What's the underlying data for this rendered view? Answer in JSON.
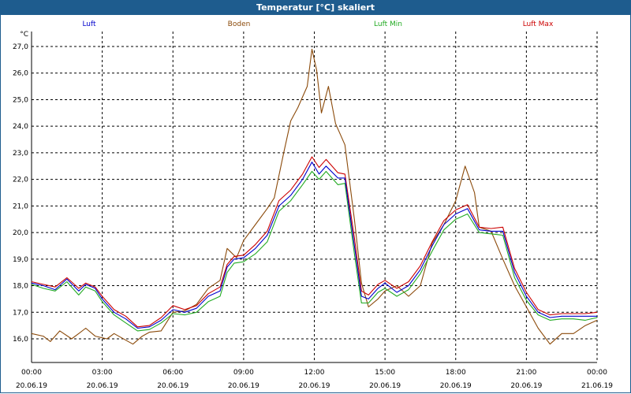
{
  "window": {
    "title": "Temperatur [°C] skaliert"
  },
  "colors": {
    "titlebar": "#1e5c8e",
    "luft": "#0000cc",
    "boden": "#8b4a0a",
    "luft_min": "#22aa22",
    "luft_max": "#cc0000",
    "grid": "#000000"
  },
  "chart_data": {
    "type": "line",
    "title": "Temperatur [°C] skaliert",
    "ylabel": "°C",
    "ylim": [
      15.5,
      27.2
    ],
    "yticks": [
      "27,0",
      "26,0",
      "25,0",
      "24,0",
      "23,0",
      "22,0",
      "21,0",
      "20,0",
      "19,0",
      "18,0",
      "17,0",
      "16,0"
    ],
    "ytick_values": [
      27,
      26,
      25,
      24,
      23,
      22,
      21,
      20,
      19,
      18,
      17,
      16
    ],
    "xlim_hours": [
      0,
      24
    ],
    "xticks": [
      {
        "hour": 0,
        "time": "00:00",
        "date": "20.06.19"
      },
      {
        "hour": 3,
        "time": "03:00",
        "date": "20.06.19"
      },
      {
        "hour": 6,
        "time": "06:00",
        "date": "20.06.19"
      },
      {
        "hour": 9,
        "time": "09:00",
        "date": "20.06.19"
      },
      {
        "hour": 12,
        "time": "12:00",
        "date": "20.06.19"
      },
      {
        "hour": 15,
        "time": "15:00",
        "date": "20.06.19"
      },
      {
        "hour": 18,
        "time": "18:00",
        "date": "20.06.19"
      },
      {
        "hour": 21,
        "time": "21:00",
        "date": "20.06.19"
      },
      {
        "hour": 24,
        "time": "00:00",
        "date": "21.06.19"
      }
    ],
    "grid": true,
    "legend_position": "top",
    "series": [
      {
        "name": "Luft",
        "color_key": "luft",
        "points": [
          [
            0,
            18.1
          ],
          [
            0.5,
            18.0
          ],
          [
            1,
            17.85
          ],
          [
            1.5,
            18.25
          ],
          [
            2,
            17.8
          ],
          [
            2.3,
            18.05
          ],
          [
            2.7,
            17.9
          ],
          [
            3,
            17.5
          ],
          [
            3.5,
            17.0
          ],
          [
            4,
            16.75
          ],
          [
            4.5,
            16.4
          ],
          [
            5,
            16.45
          ],
          [
            5.5,
            16.7
          ],
          [
            6,
            17.1
          ],
          [
            6.5,
            17.0
          ],
          [
            7,
            17.15
          ],
          [
            7.5,
            17.6
          ],
          [
            8,
            17.8
          ],
          [
            8.3,
            18.7
          ],
          [
            8.6,
            19.0
          ],
          [
            9,
            19.05
          ],
          [
            9.5,
            19.4
          ],
          [
            10,
            19.9
          ],
          [
            10.5,
            21.0
          ],
          [
            11,
            21.4
          ],
          [
            11.5,
            22.0
          ],
          [
            11.9,
            22.65
          ],
          [
            12.2,
            22.2
          ],
          [
            12.5,
            22.5
          ],
          [
            13,
            22.05
          ],
          [
            13.3,
            22.05
          ],
          [
            13.7,
            19.5
          ],
          [
            14,
            17.6
          ],
          [
            14.3,
            17.5
          ],
          [
            14.7,
            17.9
          ],
          [
            15,
            18.1
          ],
          [
            15.5,
            17.75
          ],
          [
            16,
            18.0
          ],
          [
            16.5,
            18.6
          ],
          [
            17,
            19.5
          ],
          [
            17.5,
            20.3
          ],
          [
            18,
            20.7
          ],
          [
            18.5,
            20.9
          ],
          [
            19,
            20.1
          ],
          [
            19.5,
            20.05
          ],
          [
            20,
            20.05
          ],
          [
            20.5,
            18.5
          ],
          [
            21,
            17.6
          ],
          [
            21.5,
            17.0
          ],
          [
            22,
            16.8
          ],
          [
            22.5,
            16.85
          ],
          [
            23,
            16.85
          ],
          [
            23.5,
            16.85
          ],
          [
            24,
            16.85
          ]
        ]
      },
      {
        "name": "Boden",
        "color_key": "boden",
        "points": [
          [
            0,
            16.2
          ],
          [
            0.5,
            16.1
          ],
          [
            0.8,
            15.9
          ],
          [
            1.2,
            16.3
          ],
          [
            1.7,
            16.0
          ],
          [
            2,
            16.2
          ],
          [
            2.3,
            16.4
          ],
          [
            2.7,
            16.1
          ],
          [
            3.2,
            16.0
          ],
          [
            3.5,
            16.2
          ],
          [
            4,
            15.95
          ],
          [
            4.3,
            15.8
          ],
          [
            4.7,
            16.1
          ],
          [
            5,
            16.25
          ],
          [
            5.5,
            16.3
          ],
          [
            6,
            17.0
          ],
          [
            6.5,
            17.05
          ],
          [
            7,
            17.3
          ],
          [
            7.5,
            17.9
          ],
          [
            8,
            18.2
          ],
          [
            8.3,
            19.4
          ],
          [
            8.7,
            19.05
          ],
          [
            9,
            19.7
          ],
          [
            9.5,
            20.3
          ],
          [
            10,
            20.9
          ],
          [
            10.3,
            21.3
          ],
          [
            10.7,
            23.0
          ],
          [
            11,
            24.2
          ],
          [
            11.3,
            24.7
          ],
          [
            11.7,
            25.5
          ],
          [
            11.9,
            26.9
          ],
          [
            12.1,
            26.1
          ],
          [
            12.3,
            24.5
          ],
          [
            12.6,
            25.5
          ],
          [
            12.9,
            24.1
          ],
          [
            13.3,
            23.3
          ],
          [
            13.7,
            20.5
          ],
          [
            14,
            18.1
          ],
          [
            14.3,
            17.2
          ],
          [
            14.7,
            17.5
          ],
          [
            15,
            17.8
          ],
          [
            15.5,
            18.0
          ],
          [
            16,
            17.6
          ],
          [
            16.5,
            18.0
          ],
          [
            17,
            19.6
          ],
          [
            17.5,
            20.3
          ],
          [
            18,
            21.2
          ],
          [
            18.4,
            22.5
          ],
          [
            18.8,
            21.5
          ],
          [
            19,
            20.2
          ],
          [
            19.5,
            20.05
          ],
          [
            20,
            19.0
          ],
          [
            20.5,
            18.0
          ],
          [
            21,
            17.2
          ],
          [
            21.5,
            16.4
          ],
          [
            22,
            15.8
          ],
          [
            22.5,
            16.2
          ],
          [
            23,
            16.2
          ],
          [
            23.5,
            16.5
          ],
          [
            24,
            16.7
          ]
        ]
      },
      {
        "name": "Luft Min",
        "color_key": "luft_min",
        "points": [
          [
            0,
            18.05
          ],
          [
            0.5,
            17.9
          ],
          [
            1,
            17.8
          ],
          [
            1.5,
            18.15
          ],
          [
            2,
            17.65
          ],
          [
            2.3,
            17.95
          ],
          [
            2.7,
            17.8
          ],
          [
            3,
            17.4
          ],
          [
            3.5,
            16.9
          ],
          [
            4,
            16.6
          ],
          [
            4.5,
            16.3
          ],
          [
            5,
            16.35
          ],
          [
            5.5,
            16.6
          ],
          [
            6,
            16.95
          ],
          [
            6.5,
            16.9
          ],
          [
            7,
            17.0
          ],
          [
            7.5,
            17.4
          ],
          [
            8,
            17.6
          ],
          [
            8.3,
            18.5
          ],
          [
            8.6,
            18.85
          ],
          [
            9,
            18.9
          ],
          [
            9.5,
            19.2
          ],
          [
            10,
            19.65
          ],
          [
            10.5,
            20.8
          ],
          [
            11,
            21.2
          ],
          [
            11.5,
            21.8
          ],
          [
            11.9,
            22.3
          ],
          [
            12.2,
            22.0
          ],
          [
            12.5,
            22.3
          ],
          [
            13,
            21.8
          ],
          [
            13.3,
            21.85
          ],
          [
            13.7,
            19.2
          ],
          [
            14,
            17.35
          ],
          [
            14.3,
            17.35
          ],
          [
            14.7,
            17.75
          ],
          [
            15,
            17.9
          ],
          [
            15.5,
            17.6
          ],
          [
            16,
            17.85
          ],
          [
            16.5,
            18.45
          ],
          [
            17,
            19.3
          ],
          [
            17.5,
            20.1
          ],
          [
            18,
            20.5
          ],
          [
            18.5,
            20.7
          ],
          [
            19,
            20.0
          ],
          [
            19.5,
            19.95
          ],
          [
            20,
            19.9
          ],
          [
            20.5,
            18.3
          ],
          [
            21,
            17.45
          ],
          [
            21.5,
            16.9
          ],
          [
            22,
            16.7
          ],
          [
            22.5,
            16.75
          ],
          [
            23,
            16.75
          ],
          [
            23.5,
            16.7
          ],
          [
            24,
            16.8
          ]
        ]
      },
      {
        "name": "Luft Max",
        "color_key": "luft_max",
        "points": [
          [
            0,
            18.15
          ],
          [
            0.5,
            18.05
          ],
          [
            1,
            17.95
          ],
          [
            1.5,
            18.3
          ],
          [
            2,
            17.9
          ],
          [
            2.3,
            18.1
          ],
          [
            2.7,
            17.95
          ],
          [
            3,
            17.6
          ],
          [
            3.5,
            17.1
          ],
          [
            4,
            16.85
          ],
          [
            4.5,
            16.45
          ],
          [
            5,
            16.5
          ],
          [
            5.5,
            16.8
          ],
          [
            6,
            17.25
          ],
          [
            6.5,
            17.1
          ],
          [
            7,
            17.25
          ],
          [
            7.5,
            17.7
          ],
          [
            8,
            17.95
          ],
          [
            8.3,
            18.8
          ],
          [
            8.6,
            19.1
          ],
          [
            9,
            19.15
          ],
          [
            9.5,
            19.55
          ],
          [
            10,
            20.05
          ],
          [
            10.5,
            21.2
          ],
          [
            11,
            21.6
          ],
          [
            11.5,
            22.2
          ],
          [
            11.9,
            22.85
          ],
          [
            12.2,
            22.45
          ],
          [
            12.5,
            22.75
          ],
          [
            13,
            22.25
          ],
          [
            13.3,
            22.2
          ],
          [
            13.7,
            19.8
          ],
          [
            14,
            17.8
          ],
          [
            14.3,
            17.65
          ],
          [
            14.7,
            18.05
          ],
          [
            15,
            18.2
          ],
          [
            15.5,
            17.9
          ],
          [
            16,
            18.15
          ],
          [
            16.5,
            18.75
          ],
          [
            17,
            19.65
          ],
          [
            17.5,
            20.45
          ],
          [
            18,
            20.85
          ],
          [
            18.5,
            21.05
          ],
          [
            19,
            20.2
          ],
          [
            19.5,
            20.15
          ],
          [
            20,
            20.2
          ],
          [
            20.5,
            18.65
          ],
          [
            21,
            17.75
          ],
          [
            21.5,
            17.1
          ],
          [
            22,
            16.9
          ],
          [
            22.5,
            16.95
          ],
          [
            23,
            16.95
          ],
          [
            23.5,
            16.95
          ],
          [
            24,
            17.0
          ]
        ]
      }
    ]
  }
}
